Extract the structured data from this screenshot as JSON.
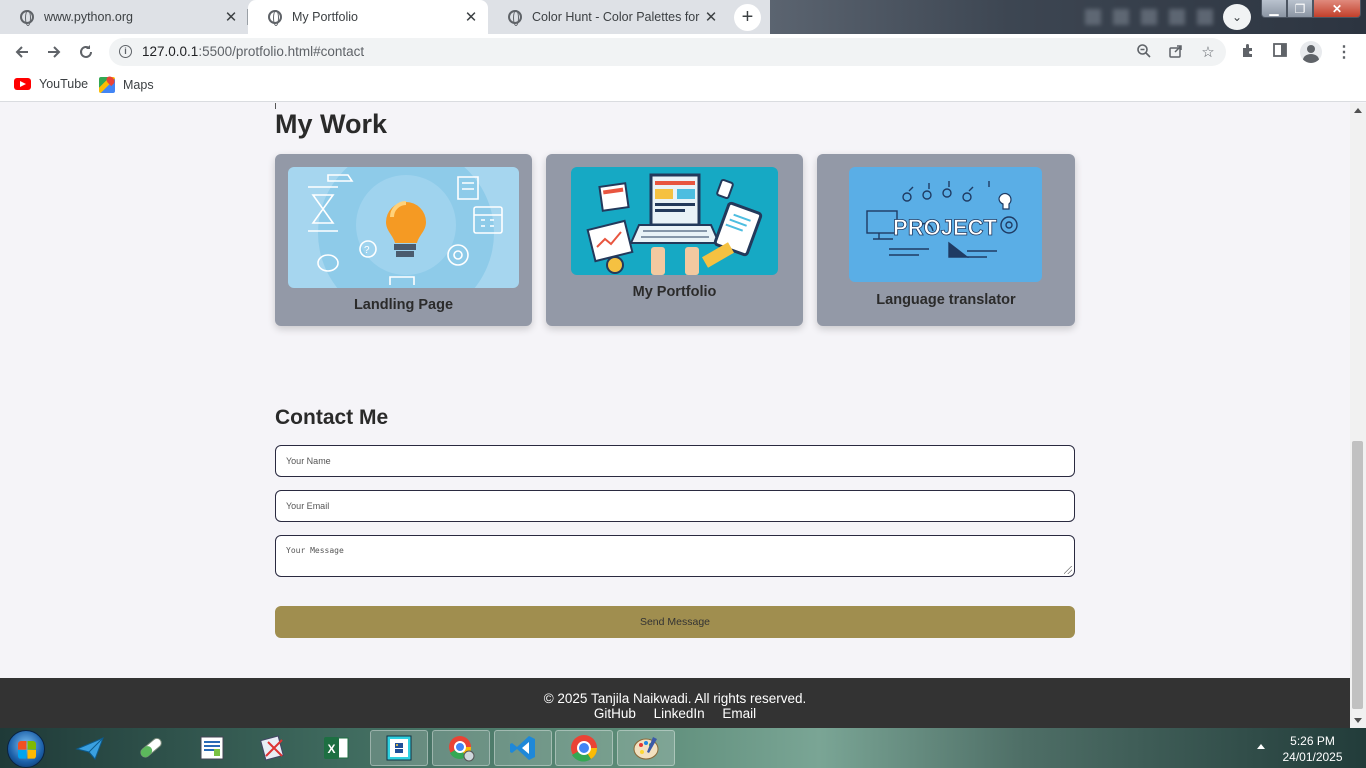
{
  "browser": {
    "tabs": [
      {
        "title": "www.python.org",
        "active": false
      },
      {
        "title": "My Portfolio",
        "active": true
      },
      {
        "title": "Color Hunt - Color Palettes for Designers and Artists",
        "active": false
      }
    ],
    "url_host": "127.0.0.1",
    "url_path": ":5500/protfolio.html#contact",
    "bookmarks": [
      {
        "label": "YouTube",
        "icon": "youtube-icon"
      },
      {
        "label": "Maps",
        "icon": "maps-icon"
      }
    ]
  },
  "page": {
    "work_title": "My Work",
    "projects": [
      {
        "label": "Landling Page",
        "image": "lightbulb-illustration"
      },
      {
        "label": "My Portfolio",
        "image": "laptop-workspace-illustration"
      },
      {
        "label": "Language translator",
        "image": "project-banner-illustration",
        "image_text": "PROJECT"
      }
    ],
    "contact_title": "Contact Me",
    "form": {
      "name_placeholder": "Your Name",
      "email_placeholder": "Your Email",
      "message_placeholder": "Your Message",
      "send_label": "Send Message"
    },
    "footer": {
      "copyright": "© 2025 Tanjila Naikwadi. All rights reserved.",
      "links": [
        "GitHub",
        "LinkedIn",
        "Email"
      ]
    }
  },
  "taskbar": {
    "apps": [
      "paper-plane-app",
      "pill-app",
      "document-app",
      "scissors-app",
      "excel-app",
      "python-idle-app",
      "chrome-user-app",
      "vscode-app",
      "chrome-app",
      "paint-app"
    ],
    "time": "5:26 PM",
    "date": "24/01/2025"
  },
  "colors": {
    "card_bg": "#9399a7",
    "send_button": "#a08e4f",
    "footer_bg": "#333333",
    "page_bg": "#f5f4f8"
  }
}
